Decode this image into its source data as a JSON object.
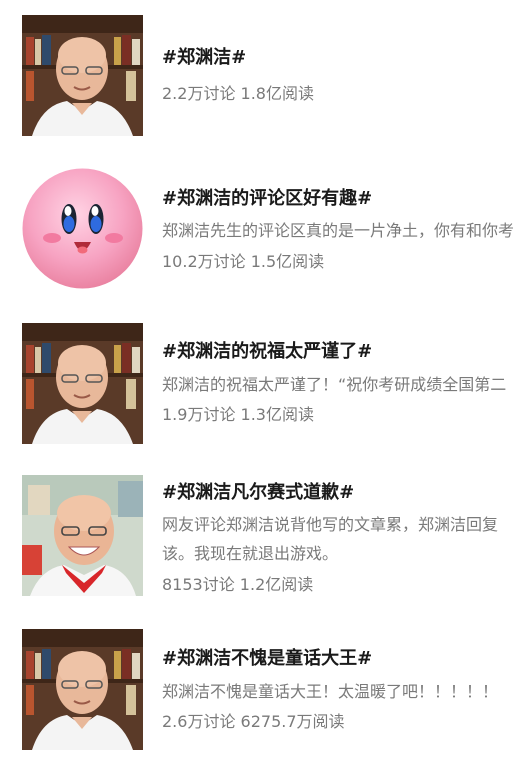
{
  "topics": [
    {
      "title": "#郑渊洁#",
      "snippet_lines": [],
      "stats": "2.2万讨论 1.8亿阅读",
      "thumbnail": "man-bookshelf-photo"
    },
    {
      "title": "#郑渊洁的评论区好有趣#",
      "snippet_lines": [
        "郑渊洁先生的评论区真的是一片净土，你有和你考"
      ],
      "stats": "10.2万讨论 1.5亿阅读",
      "thumbnail": "pink-round-character"
    },
    {
      "title": "#郑渊洁的祝福太严谨了#",
      "snippet_lines": [
        "郑渊洁的祝福太严谨了！“祝你考研成绩全国第二"
      ],
      "stats": "1.9万讨论 1.3亿阅读",
      "thumbnail": "man-bookshelf-photo"
    },
    {
      "title": "#郑渊洁凡尔赛式道歉#",
      "snippet_lines": [
        "网友评论郑渊洁说背他写的文章累，郑渊洁回复",
        "该。我现在就退出游戏。"
      ],
      "stats": "8153讨论 1.2亿阅读",
      "thumbnail": "man-red-scarf-photo"
    },
    {
      "title": "#郑渊洁不愧是童话大王#",
      "snippet_lines": [
        "郑渊洁不愧是童话大王！太温暖了吧！！！！！"
      ],
      "stats": "2.6万讨论 6275.7万阅读",
      "thumbnail": "man-bookshelf-photo"
    }
  ]
}
